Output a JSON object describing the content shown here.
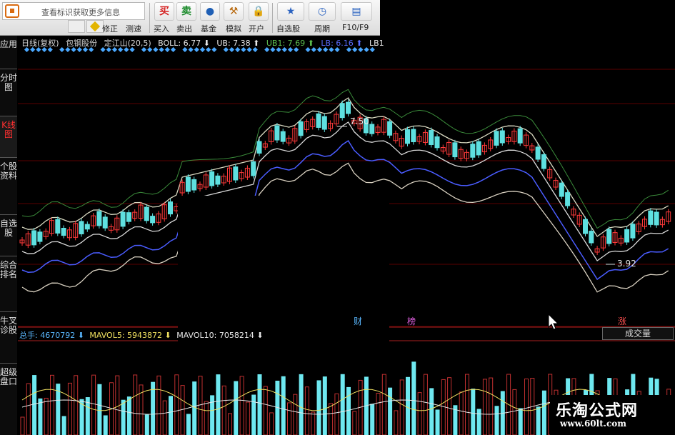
{
  "toolbar": {
    "search_text": "查看标识获取更多信息",
    "buttons": [
      {
        "label": "修正"
      },
      {
        "label": "测速"
      },
      {
        "label": "买入",
        "glyph": "买",
        "color": "#d42020"
      },
      {
        "label": "卖出",
        "glyph": "卖",
        "color": "#1a8a2a"
      },
      {
        "label": "基金",
        "glyph": "●",
        "color": "#1f5fb5"
      },
      {
        "label": "模拟",
        "glyph": "⚒",
        "color": "#b86a10"
      },
      {
        "label": "开户",
        "glyph": "🔒",
        "color": "#888888"
      },
      {
        "label": "自选股",
        "glyph": "★",
        "color": "#2a62c0"
      },
      {
        "label": "周期",
        "glyph": "◷",
        "color": "#2a62c0"
      },
      {
        "label": "F10/F9",
        "glyph": "▤",
        "color": "#2a62c0"
      }
    ]
  },
  "sidebar": {
    "tabs": [
      {
        "label": "应用"
      },
      {
        "label": "分时图"
      },
      {
        "label": "K线图",
        "active": true
      },
      {
        "label": "个股资料"
      },
      {
        "label": "自选股"
      },
      {
        "label": "综合排名"
      },
      {
        "label": "牛叉诊股"
      },
      {
        "label": "超级盘口"
      }
    ]
  },
  "chart": {
    "legend": [
      {
        "text": "日线(复权)",
        "color": "#d8d8d8"
      },
      {
        "text": "包钢股份",
        "color": "#d8d8d8"
      },
      {
        "text": "定江山(20,5)",
        "color": "#d8d8d8"
      },
      {
        "text": "BOLL: 6.77 ⬇",
        "color": "#e8e8e8"
      },
      {
        "text": "UB: 7.38 ⬆",
        "color": "#e8e8e8"
      },
      {
        "text": "UB1: 7.69 ⬆",
        "color": "#5ec050"
      },
      {
        "text": "LB: 6.16 ⬆",
        "color": "#5a6cff"
      },
      {
        "text": "LB1",
        "color": "#e8e8e8"
      }
    ],
    "price_high_label": "7.50",
    "price_low_label": "3.92",
    "markers": [
      {
        "text": "财",
        "color": "#5ab8ff"
      },
      {
        "text": "榜",
        "color": "#e060e0"
      },
      {
        "text": "涨",
        "color": "#ff5050"
      }
    ]
  },
  "volume": {
    "legend": [
      {
        "text": "总手: 4670792 ⬇",
        "color": "#5ab8ff"
      },
      {
        "text": "MAVOL5: 5943872 ⬇",
        "color": "#f0e060"
      },
      {
        "text": "MAVOL10: 7058214 ⬇",
        "color": "#e8e8e8"
      }
    ],
    "selector": "成交量"
  },
  "watermark": {
    "title": "乐淘公式网",
    "url": "www.60lt.com"
  },
  "colors": {
    "up": "#ff3a3a",
    "down": "#5ee0e0",
    "grid": "#5a0000"
  }
}
